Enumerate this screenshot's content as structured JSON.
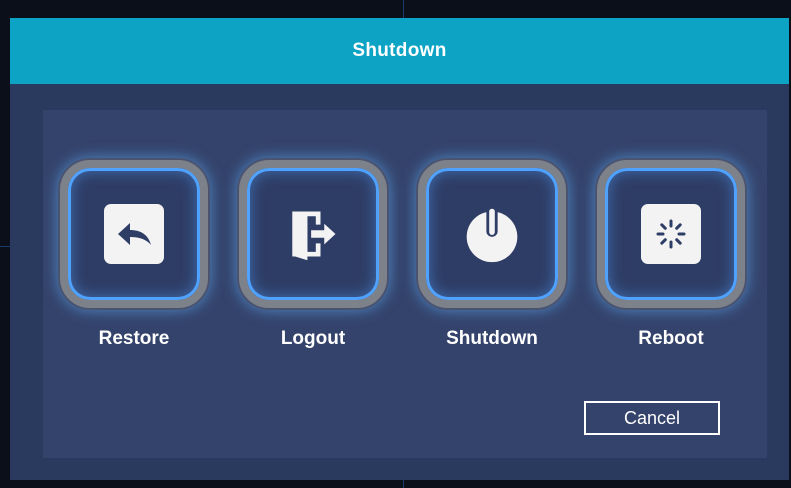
{
  "dialog": {
    "title": "Shutdown"
  },
  "actions": [
    {
      "label": "Restore",
      "icon": "restore-icon"
    },
    {
      "label": "Logout",
      "icon": "logout-icon"
    },
    {
      "label": "Shutdown",
      "icon": "power-icon"
    },
    {
      "label": "Reboot",
      "icon": "reboot-icon"
    }
  ],
  "cancel_label": "Cancel",
  "colors": {
    "titlebar": "#0ca3c4",
    "dialog_bg": "#2a3a5e",
    "panel_bg": "#34436b",
    "glow": "#4fa2ff",
    "frame": "#7d8189",
    "text": "#ffffff"
  }
}
